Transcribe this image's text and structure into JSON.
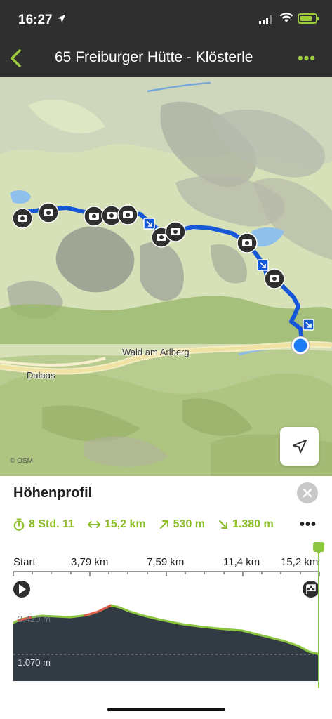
{
  "status_bar": {
    "time": "16:27"
  },
  "nav": {
    "title": "65 Freiburger Hütte - Klösterle",
    "more": "•••"
  },
  "map": {
    "labels": {
      "town1": "Wald am Arlberg",
      "town2": "Dalaas"
    },
    "attribution": "© OSM"
  },
  "profile": {
    "title": "Höhenprofil",
    "stats": {
      "duration": "8 Std. 11",
      "distance": "15,2 km",
      "ascent": "530 m",
      "descent": "1.380 m"
    },
    "more": "•••",
    "axis": {
      "start": "Start",
      "t1": "3,79 km",
      "t2": "7,59 km",
      "t3": "11,4 km",
      "t4": "15,2 km"
    },
    "elev_high": "2.420 m",
    "elev_low": "1.070 m"
  },
  "colors": {
    "accent": "#8cbd2a",
    "route": "#1557d6",
    "dark": "#2f2f2f",
    "profile_fill": "#323a44"
  }
}
